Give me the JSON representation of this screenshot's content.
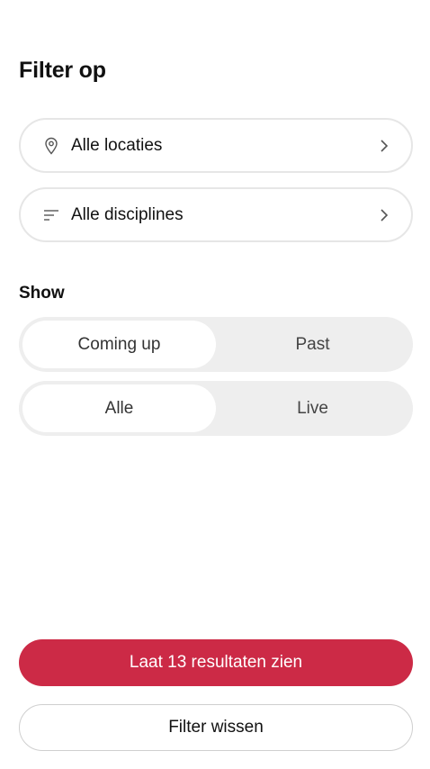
{
  "header": {
    "title": "Filter op"
  },
  "filters": {
    "location": {
      "label": "Alle locaties",
      "icon": "location-pin-icon"
    },
    "discipline": {
      "label": "Alle disciplines",
      "icon": "list-filter-icon"
    },
    "chevron_icon": "chevron-right-icon"
  },
  "show": {
    "label": "Show",
    "time_toggle": {
      "options": [
        "Coming up",
        "Past"
      ],
      "selected": "Coming up"
    },
    "type_toggle": {
      "options": [
        "Alle",
        "Live"
      ],
      "selected": "Alle"
    }
  },
  "actions": {
    "primary_label": "Laat 13 resultaten zien",
    "secondary_label": "Filter wissen"
  },
  "colors": {
    "primary": "#cc2a46",
    "toggle_bg": "#eeeeee",
    "border": "#e6e6e6"
  }
}
